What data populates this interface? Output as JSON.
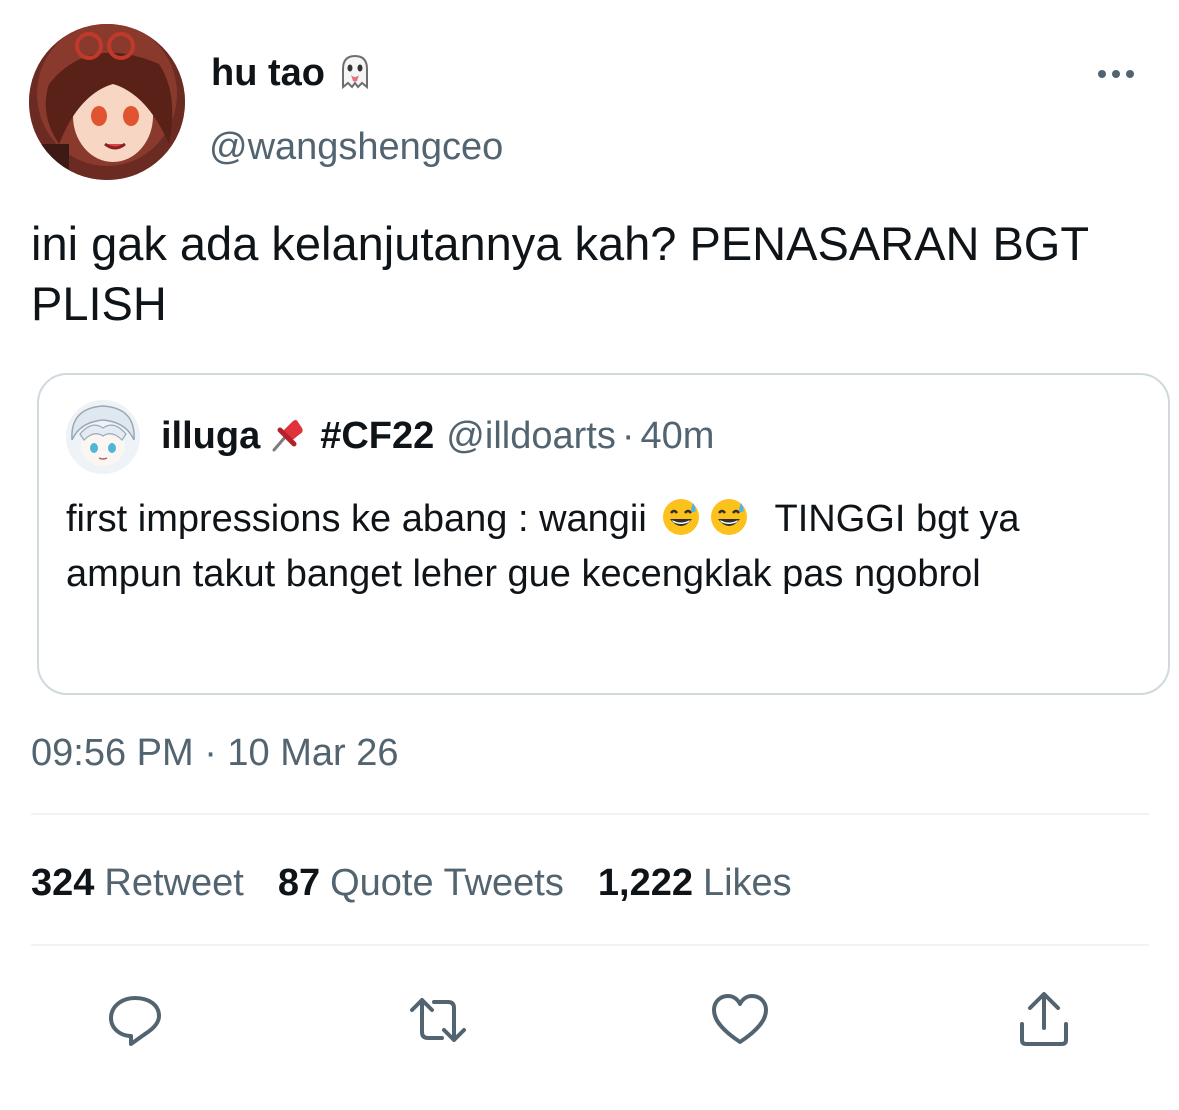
{
  "author": {
    "display_name": "hu tao",
    "handle": "@wangshengceo",
    "name_emoji": "ghost-icon"
  },
  "tweet": {
    "text": "ini gak ada kelanjutannya kah? PENASARAN BGT PLISH",
    "timestamp": "09:56 PM · 10 Mar 26"
  },
  "quote": {
    "name": "illuga",
    "tag": "#CF22",
    "handle": "@illdoarts",
    "separator": "·",
    "time": "40m",
    "text_before": "first impressions ke abang : wangii",
    "text_after": "TINGGI bgt ya ampun takut banget leher gue kecengklak pas ngobrol"
  },
  "stats": [
    {
      "count": "324",
      "label": "Retweet"
    },
    {
      "count": "87",
      "label": "Quote Tweets"
    },
    {
      "count": "1,222",
      "label": "Likes"
    }
  ],
  "colors": {
    "text": "#0f1419",
    "secondary": "#536471",
    "border": "#cfd9de",
    "divider": "#eff3f4"
  }
}
